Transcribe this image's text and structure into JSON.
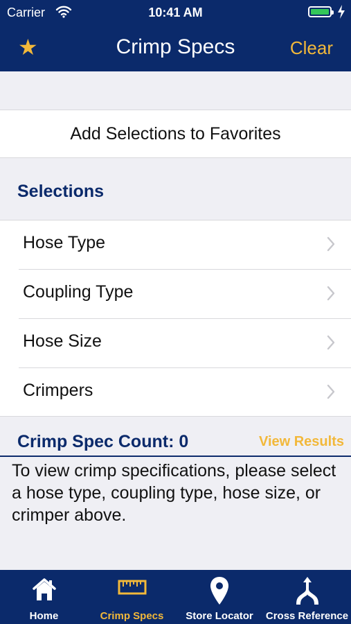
{
  "status_bar": {
    "carrier": "Carrier",
    "time": "10:41 AM"
  },
  "nav": {
    "title": "Crimp Specs",
    "clear_label": "Clear",
    "favorite_icon": "star-icon"
  },
  "favorites_row": {
    "label": "Add Selections to Favorites"
  },
  "selections": {
    "header": "Selections",
    "items": [
      {
        "label": "Hose Type"
      },
      {
        "label": "Coupling Type"
      },
      {
        "label": "Hose Size"
      },
      {
        "label": "Crimpers"
      }
    ]
  },
  "results": {
    "count_label": "Crimp Spec Count: 0",
    "view_results_label": "View Results",
    "instructions": "To view crimp specifications, please select a hose type, coupling type, hose size, or crimper above."
  },
  "tabs": [
    {
      "label": "Home",
      "icon": "home-icon",
      "active": false
    },
    {
      "label": "Crimp Specs",
      "icon": "ruler-icon",
      "active": true
    },
    {
      "label": "Store Locator",
      "icon": "map-pin-icon",
      "active": false
    },
    {
      "label": "Cross Reference",
      "icon": "cross-reference-icon",
      "active": false
    }
  ],
  "colors": {
    "brand_navy": "#0b2a6b",
    "accent_gold": "#f2b83a",
    "battery_green": "#34c759"
  }
}
